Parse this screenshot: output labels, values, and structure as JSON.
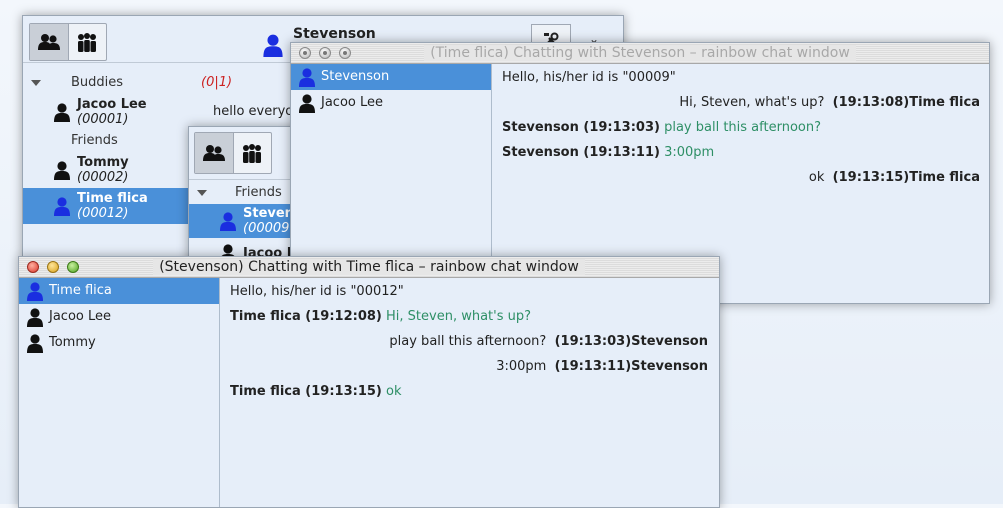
{
  "buddy_window": {
    "user_name": "Stevenson",
    "groups": [
      {
        "name": "Buddies",
        "count": "(0|1)"
      },
      {
        "name": "Friends"
      }
    ],
    "buddies": [
      {
        "name": "Jacoo Lee",
        "id": "(00001)",
        "preview": "hello everyo"
      },
      {
        "name": "Tommy",
        "id": "(00002)"
      },
      {
        "name": "Time flica",
        "id": "(00012)"
      }
    ]
  },
  "buddy_window_2": {
    "group": "Friends",
    "items": [
      {
        "name": "Steven",
        "id": "(00009"
      },
      {
        "name": "Jacoo L"
      }
    ]
  },
  "chat_window_1": {
    "title": "(Time flica) Chatting with Stevenson – rainbow chat window",
    "contacts": [
      "Stevenson",
      "Jacoo Lee"
    ],
    "system_line": "Hello, his/her id is \"00009\"",
    "messages": [
      {
        "align": "right",
        "text": "Hi, Steven, what's up?",
        "meta": "(19:13:08)Time flica"
      },
      {
        "align": "left",
        "meta": "Stevenson (19:13:03)",
        "text": "play ball this afternoon?"
      },
      {
        "align": "left",
        "meta": "Stevenson (19:13:11)",
        "text": "3:00pm"
      },
      {
        "align": "right",
        "text": "ok",
        "meta": "(19:13:15)Time flica"
      }
    ]
  },
  "chat_window_2": {
    "title": "(Stevenson) Chatting with Time flica – rainbow chat window",
    "contacts": [
      "Time flica",
      "Jacoo Lee",
      "Tommy"
    ],
    "system_line": "Hello, his/her id is \"00012\"",
    "messages": [
      {
        "align": "left",
        "meta": "Time flica (19:12:08)",
        "text": "Hi, Steven, what's up?"
      },
      {
        "align": "right",
        "text": "play ball this afternoon?",
        "meta": "(19:13:03)Stevenson"
      },
      {
        "align": "right",
        "text": "3:00pm",
        "meta": "(19:13:11)Stevenson"
      },
      {
        "align": "left",
        "meta": "Time flica (19:13:15)",
        "text": "ok"
      }
    ]
  },
  "colors": {
    "selection": "#4a90d9",
    "green_text": "#2e8f66",
    "count_red": "#cc2222",
    "icon_blue": "#1a2ee0"
  }
}
